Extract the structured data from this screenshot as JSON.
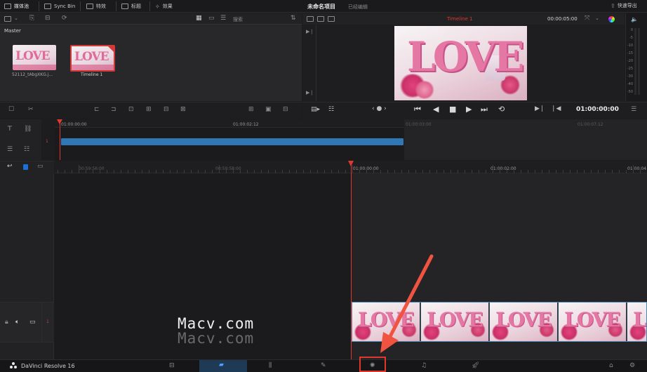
{
  "top_bar": {
    "media_pool_label": "媒体池",
    "sync_bin_label": "Sync Bin",
    "effects_label": "特效",
    "titles_label": "标题",
    "fx_label": "效果",
    "project_title": "未命名项目",
    "edit_mode_label": "已经编辑",
    "quick_export_label": "快速导出"
  },
  "media_pool": {
    "search_placeholder": "搜索",
    "bin_name": "Master",
    "clips": [
      {
        "name": "52112_tAbgXKG.j...",
        "thumb_text": "LOVE"
      },
      {
        "name": "Timeline 1",
        "thumb_text": "LOVE"
      }
    ]
  },
  "viewer": {
    "timeline_name": "Timeline 1",
    "duration": "00:00:05:00",
    "timecode": "01:00:00:00",
    "preview_text": "LOVE",
    "audio_meter_marks": [
      "0",
      "-5",
      "-10",
      "-15",
      "-20",
      "-25",
      "-30",
      "-40",
      "-50"
    ]
  },
  "upper_timeline": {
    "ruler_labels": [
      "01:00:00:00",
      "01:00:02:12",
      "01:00:03:00",
      "01:00:07:12"
    ],
    "track_number": "1"
  },
  "lower_timeline": {
    "ruler_labels": [
      "00:59:56:00",
      "00:59:58:00",
      "01:00:00:00",
      "01:00:02:00",
      "01:00:04"
    ],
    "audio_track_number": "1",
    "clip_frames": [
      "LOVE",
      "LOVE",
      "LOVE",
      "LOVE",
      "LOVE"
    ]
  },
  "watermark": {
    "line1": "Macv.com",
    "line2": "Macv.com"
  },
  "bottom_bar": {
    "app_name": "DaVinci Resolve 16"
  },
  "colors": {
    "accent_red": "#e0382c",
    "clip_blue": "#2f78b5",
    "highlight_box": "#e0382c",
    "arrow": "#f0533f"
  }
}
